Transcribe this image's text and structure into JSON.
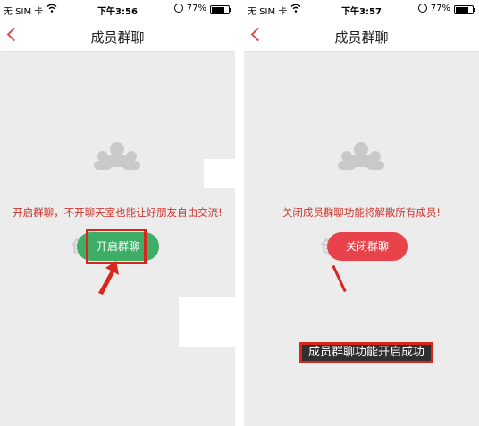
{
  "screens": [
    {
      "status": {
        "carrier": "无 SIM 卡",
        "time": "下午3:56",
        "battery": "77%",
        "battery_level": 0.77
      },
      "nav": {
        "title": "成员群聊"
      },
      "message": "开启群聊，不开聊天室也能让好朋友自由交流!",
      "button_label": "开启群聊",
      "watermark": "创业"
    },
    {
      "status": {
        "carrier": "无 SIM 卡",
        "time": "下午3:57",
        "battery": "77%",
        "battery_level": 0.77
      },
      "nav": {
        "title": "成员群聊"
      },
      "message": "关闭成员群聊功能将解散所有成员!",
      "button_label": "关闭群聊",
      "watermark": "创业",
      "toast": "成员群聊功能开启成功"
    }
  ],
  "colors": {
    "accent_red": "#e04b4b",
    "message_red": "#d0342c",
    "open_green": "#3eae67",
    "close_red": "#e8434a",
    "annotation_red": "#d7261e"
  },
  "icons": [
    "back-chevron-icon",
    "wifi-icon",
    "rotation-lock-icon",
    "battery-icon",
    "group-members-icon",
    "annotation-arrow-icon"
  ]
}
